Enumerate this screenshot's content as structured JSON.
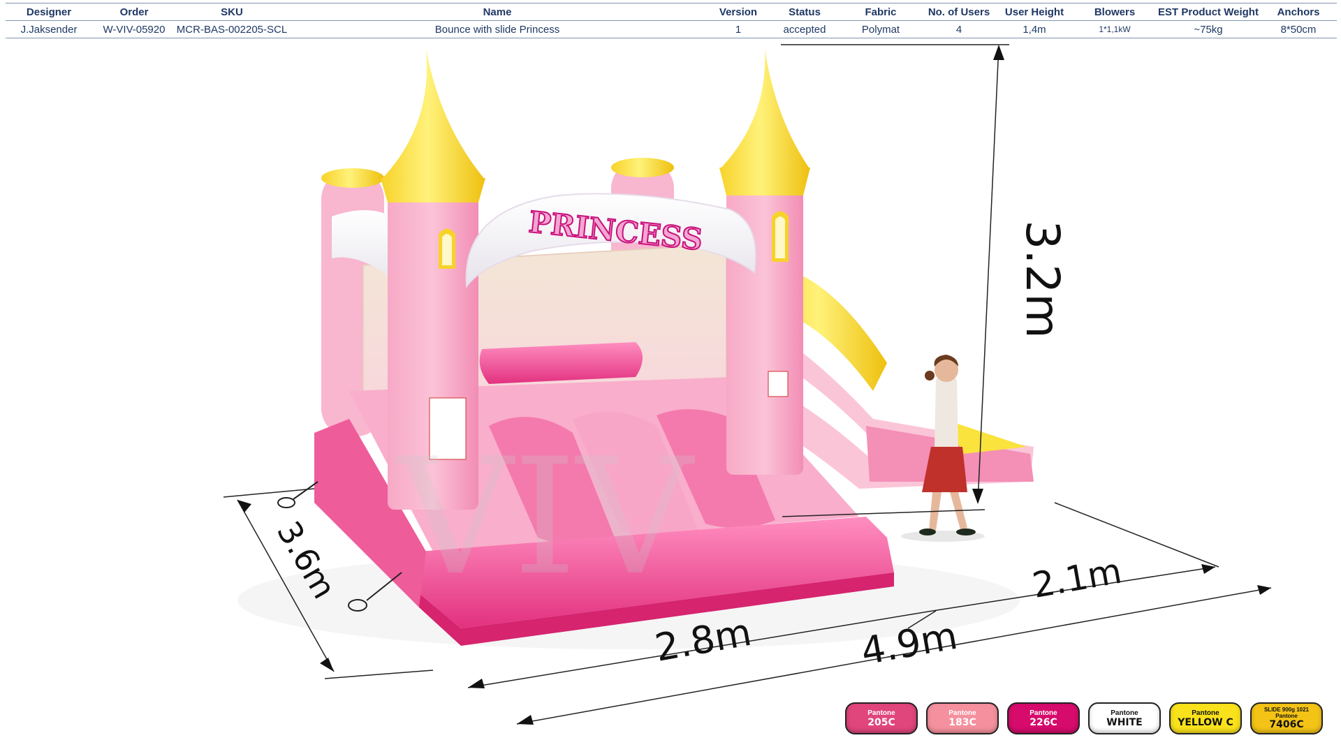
{
  "table": {
    "headers": [
      "Designer",
      "Order",
      "SKU",
      "Name",
      "Version",
      "Status",
      "Fabric",
      "No. of Users",
      "User  Height",
      "Blowers",
      "EST Product Weight",
      "Anchors"
    ],
    "row": [
      "J.Jaksender",
      "W-VIV-05920",
      "MCR-BAS-002205-SCL",
      "Bounce with slide Princess",
      "1",
      "accepted",
      "Polymat",
      "4",
      "1,4m",
      "1*1,1kW",
      "~75kg",
      "8*50cm"
    ]
  },
  "product": {
    "banner_text": "PRINCESS",
    "watermark": "VIV"
  },
  "dimensions": {
    "height": "3.2m",
    "depth": "3.6m",
    "width_bouncer": "2.8m",
    "width_slide": "2.1m",
    "width_total": "4.9m"
  },
  "swatches": [
    {
      "label": "Pantone",
      "code": "205C",
      "color": "#e0457b",
      "text": "#ffffff"
    },
    {
      "label": "Pantone",
      "code": "183C",
      "color": "#f5909e",
      "text": "#ffffff"
    },
    {
      "label": "Pantone",
      "code": "226C",
      "color": "#d60b6c",
      "text": "#ffffff"
    },
    {
      "label": "Pantone",
      "code": "WHITE",
      "color": "#ffffff",
      "text": "#111111"
    },
    {
      "label": "Pantone",
      "code": "YELLOW C",
      "color": "#f9e21c",
      "text": "#111111"
    },
    {
      "label": "SLIDE 900g 1021\nPantone",
      "code": "7406C",
      "color": "#f3c316",
      "text": "#111111"
    }
  ]
}
